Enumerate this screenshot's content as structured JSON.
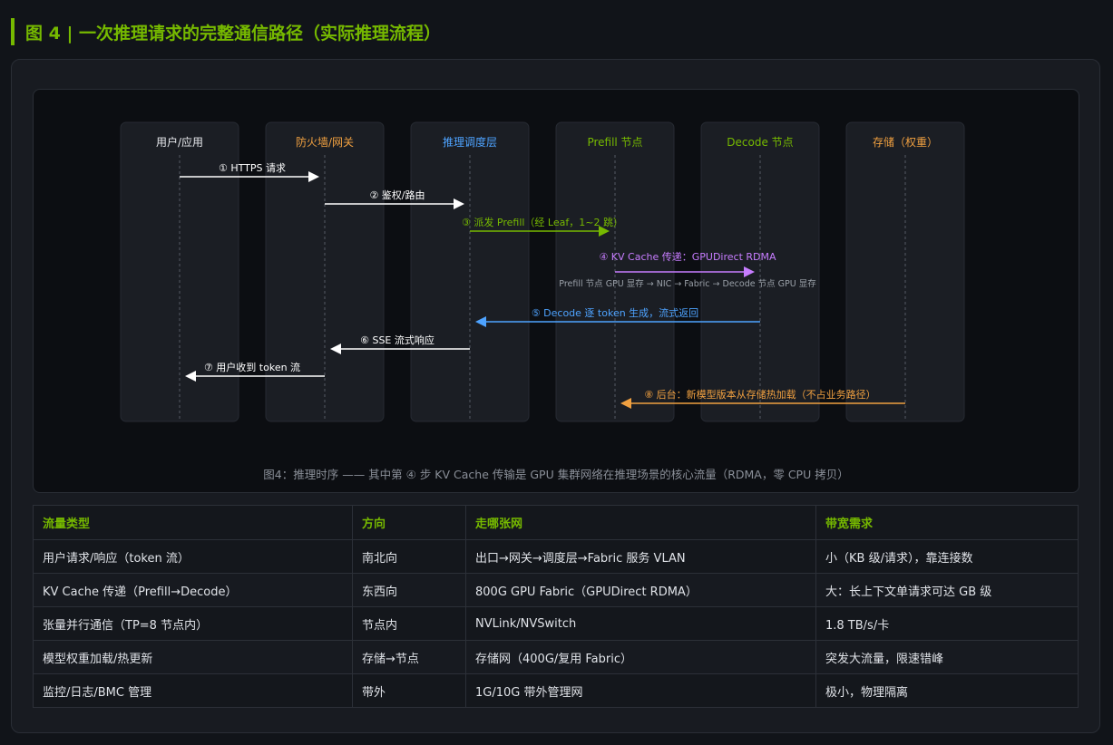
{
  "title": "图 4 | 一次推理请求的完整通信路径（实际推理流程）",
  "lanes": [
    {
      "label": "用户/应用",
      "color": "#e8eaee"
    },
    {
      "label": "防火墙/网关",
      "color": "#f0a040"
    },
    {
      "label": "推理调度层",
      "color": "#4ea3ff"
    },
    {
      "label": "Prefill 节点",
      "color": "#76b900"
    },
    {
      "label": "Decode 节点",
      "color": "#76b900"
    },
    {
      "label": "存储（权重）",
      "color": "#f0a040"
    }
  ],
  "messages": [
    {
      "from": 0,
      "to": 1,
      "label": "① HTTPS 请求",
      "color": "#ffffff",
      "label_color": "#ffffff"
    },
    {
      "from": 1,
      "to": 2,
      "label": "② 鉴权/路由",
      "color": "#ffffff",
      "label_color": "#ffffff"
    },
    {
      "from": 2,
      "to": 3,
      "label": "③ 派发 Prefill（经 Leaf，1~2 跳）",
      "color": "#76b900",
      "label_color": "#76b900"
    },
    {
      "from": 3,
      "to": 4,
      "label": "④ KV Cache 传递：GPUDirect RDMA",
      "sublabel": "Prefill 节点 GPU 显存 → NIC → Fabric → Decode 节点 GPU 显存",
      "color": "#c77dff",
      "label_color": "#c77dff"
    },
    {
      "from": 4,
      "to": 2,
      "label": "⑤ Decode 逐 token 生成，流式返回",
      "color": "#4ea3ff",
      "label_color": "#4ea3ff"
    },
    {
      "from": 2,
      "to": 1,
      "label": "⑥ SSE 流式响应",
      "color": "#ffffff",
      "label_color": "#ffffff"
    },
    {
      "from": 1,
      "to": 0,
      "label": "⑦ 用户收到 token 流",
      "color": "#ffffff",
      "label_color": "#ffffff"
    },
    {
      "from": 5,
      "to": 3,
      "label": "⑧ 后台：新模型版本从存储热加载（不占业务路径）",
      "color": "#f0a040",
      "label_color": "#f0a040"
    }
  ],
  "caption": "图4：推理时序 —— 其中第 ④ 步 KV Cache 传输是 GPU 集群网络在推理场景的核心流量（RDMA，零 CPU 拷贝）",
  "table": {
    "headers": [
      "流量类型",
      "方向",
      "走哪张网",
      "带宽需求"
    ],
    "rows": [
      [
        "用户请求/响应（token 流）",
        "南北向",
        "出口→网关→调度层→Fabric 服务 VLAN",
        "小（KB 级/请求），靠连接数"
      ],
      [
        "KV Cache 传递（Prefill→Decode）",
        "东西向",
        "800G GPU Fabric（GPUDirect RDMA）",
        "大：长上下文单请求可达 GB 级"
      ],
      [
        "张量并行通信（TP=8 节点内）",
        "节点内",
        "NVLink/NVSwitch",
        "1.8 TB/s/卡"
      ],
      [
        "模型权重加载/热更新",
        "存储→节点",
        "存储网（400G/复用 Fabric）",
        "突发大流量，限速错峰"
      ],
      [
        "监控/日志/BMC 管理",
        "带外",
        "1G/10G 带外管理网",
        "极小，物理隔离"
      ]
    ]
  }
}
